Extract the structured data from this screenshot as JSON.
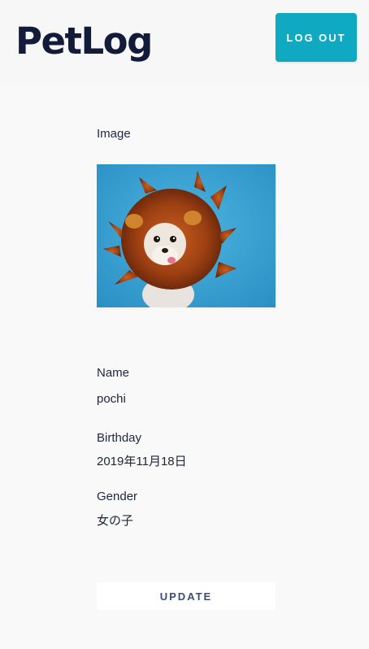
{
  "app": {
    "logo": "PetLog",
    "logout_label": "LOG OUT"
  },
  "colors": {
    "accent": "#10a9c2",
    "logo": "#131b3b",
    "background": "#f9f9f9"
  },
  "pet": {
    "image_label": "Image",
    "name_label": "Name",
    "name": "pochi",
    "birthday_label": "Birthday",
    "birthday": "2019年11月18日",
    "gender_label": "Gender",
    "gender": "女の子"
  },
  "actions": {
    "update_label": "UPDATE"
  }
}
